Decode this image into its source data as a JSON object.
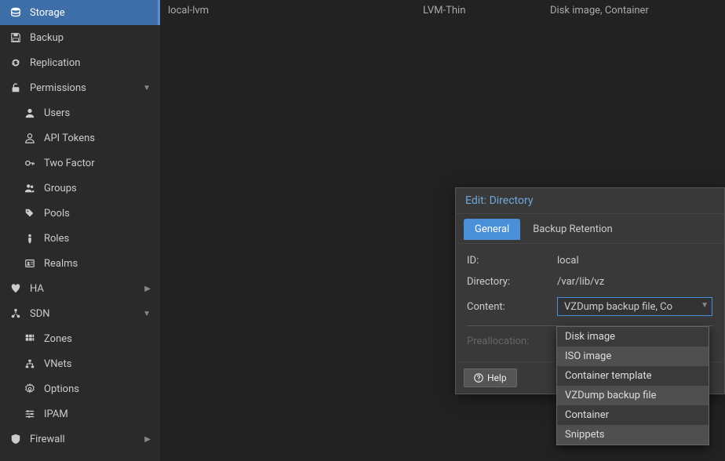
{
  "sidebar": {
    "items": [
      {
        "label": "Storage",
        "icon": "database"
      },
      {
        "label": "Backup",
        "icon": "floppy"
      },
      {
        "label": "Replication",
        "icon": "sync"
      },
      {
        "label": "Permissions",
        "icon": "unlock",
        "expand": "down"
      },
      {
        "label": "Users",
        "icon": "user"
      },
      {
        "label": "API Tokens",
        "icon": "user-outline"
      },
      {
        "label": "Two Factor",
        "icon": "key"
      },
      {
        "label": "Groups",
        "icon": "users"
      },
      {
        "label": "Pools",
        "icon": "tags"
      },
      {
        "label": "Roles",
        "icon": "person"
      },
      {
        "label": "Realms",
        "icon": "id-card"
      },
      {
        "label": "HA",
        "icon": "heartbeat",
        "expand": "right"
      },
      {
        "label": "SDN",
        "icon": "sdn",
        "expand": "down"
      },
      {
        "label": "Zones",
        "icon": "grid"
      },
      {
        "label": "VNets",
        "icon": "network"
      },
      {
        "label": "Options",
        "icon": "gear"
      },
      {
        "label": "IPAM",
        "icon": "sliders"
      },
      {
        "label": "Firewall",
        "icon": "shield",
        "expand": "right"
      }
    ]
  },
  "table": {
    "rows": [
      {
        "name": "local-lvm",
        "type": "LVM-Thin",
        "content": "Disk image, Container"
      }
    ]
  },
  "dialog": {
    "title": "Edit: Directory",
    "tabs": [
      {
        "label": "General"
      },
      {
        "label": "Backup Retention"
      }
    ],
    "fields": {
      "id_label": "ID:",
      "id_value": "local",
      "directory_label": "Directory:",
      "directory_value": "/var/lib/vz",
      "content_label": "Content:",
      "content_value": "VZDump backup file, Co",
      "prealloc_label": "Preallocation:"
    },
    "help_label": "Help"
  },
  "dropdown": {
    "items": [
      {
        "label": "Disk image",
        "selected": false
      },
      {
        "label": "ISO image",
        "selected": true
      },
      {
        "label": "Container template",
        "selected": false
      },
      {
        "label": "VZDump backup file",
        "selected": true
      },
      {
        "label": "Container",
        "selected": false
      },
      {
        "label": "Snippets",
        "selected": true
      }
    ]
  }
}
